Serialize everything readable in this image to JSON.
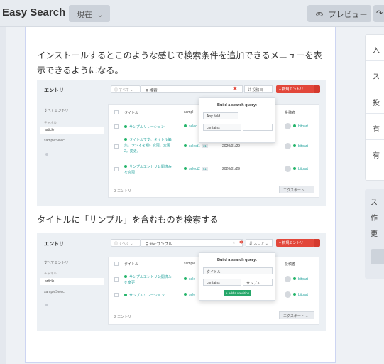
{
  "header": {
    "app_title": "Easy Search",
    "version_label": "現在",
    "version_chevron": "⌄",
    "preview_icon": "eye-icon",
    "preview_label": "プレビュー",
    "publish_icon": "curved-arrow-icon",
    "publish_glyph": "↷"
  },
  "colors": {
    "accent_red": "#e2473a",
    "status_green": "#25b56b",
    "link_teal": "#2aa5a0",
    "editor_border": "#cdd5f2"
  },
  "sidebar": {
    "fields": [
      "入",
      "ス",
      "投",
      "有",
      "有"
    ],
    "help_lines": [
      "ス",
      "作",
      "更"
    ]
  },
  "content": {
    "paragraph1": "インストールするとこのような感じで検索条件を追加できるメニューを表示できるようになる。",
    "paragraph2": "タイトルに「サンプル」を含むものを検索する"
  },
  "screenshot1": {
    "title": "エントリ",
    "filter_label": "すべて",
    "search_text": "検索",
    "sort_label": "投稿日",
    "new_entry": "新規エントリ",
    "nav": [
      "すべてエントリ",
      "チャネル",
      "article",
      "sampleSelect"
    ],
    "nav_selected": "article",
    "columns": {
      "title": "タイトル",
      "section": "sampl",
      "author": "投稿者"
    },
    "rows": [
      {
        "title": "サンプルリレーション",
        "section": "selec",
        "date": "",
        "author": "bitpart"
      },
      {
        "title": "タイトルです。タイトル編集。ラジオを順に変更。変更2。変更。",
        "section": "select1",
        "badge": "v1",
        "date": "2020/01/29",
        "author": "bitpart"
      },
      {
        "title": "サンプルエントリ公開済みを変更",
        "section": "select2",
        "badge": "v1",
        "date": "2020/01/29",
        "author": "bitpart"
      }
    ],
    "count": "3 エントリ",
    "export": "エクスポート…",
    "popup": {
      "heading": "Build a search query:",
      "field": "Any field",
      "operator": "contains",
      "value": ""
    }
  },
  "screenshot2": {
    "title": "エントリ",
    "filter_label": "すべて",
    "search_text": "title:サンプル",
    "sort_label": "スコア",
    "new_entry": "新規エントリ",
    "nav": [
      "すべてエントリ",
      "チャネル",
      "article",
      "sampleSelect"
    ],
    "nav_selected": "article",
    "columns": {
      "title": "タイトル",
      "section": "sample",
      "author": "投稿者"
    },
    "rows": [
      {
        "title": "サンプルエントリ公開済みを変更",
        "section": "sele",
        "author": "bitpart"
      },
      {
        "title": "サンプルリレーション",
        "section": "sele",
        "author": "bitpart"
      }
    ],
    "count": "2 エントリ",
    "export": "エクスポート…",
    "popup": {
      "heading": "Build a search query:",
      "field": "タイトル",
      "operator": "contains",
      "value": "サンプル",
      "add_label": "+ Add a condition"
    }
  }
}
